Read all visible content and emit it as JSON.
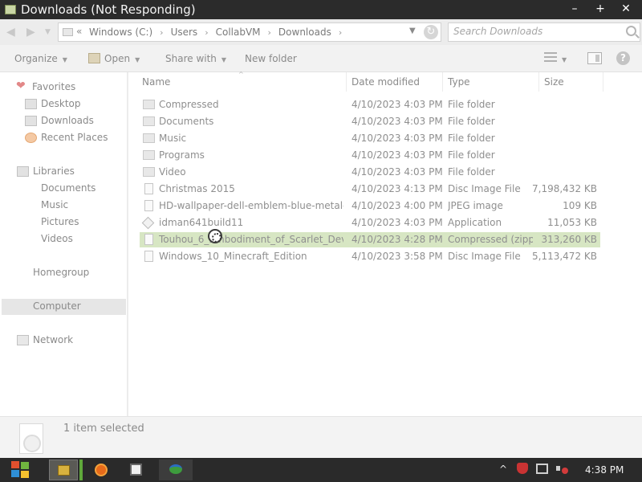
{
  "window": {
    "title": "Downloads (Not Responding)",
    "min_glyph": "–",
    "max_glyph": "+",
    "close_glyph": "✕"
  },
  "address": {
    "back_glyph": "◀",
    "forward_glyph": "▶",
    "recent_glyph": "▼",
    "overflow": "«",
    "crumbs": [
      "Windows (C:)",
      "Users",
      "CollabVM",
      "Downloads"
    ],
    "separator": "›",
    "dropdown_glyph": "▼",
    "refresh_glyph": "↻",
    "search_placeholder": "Search Downloads"
  },
  "toolbar": {
    "organize": "Organize",
    "open": "Open",
    "share_with": "Share with",
    "new_folder": "New folder",
    "caret": "▼",
    "help": "?"
  },
  "nav": {
    "favorites": "Favorites",
    "desktop": "Desktop",
    "downloads": "Downloads",
    "recent_places": "Recent Places",
    "libraries": "Libraries",
    "documents": "Documents",
    "music": "Music",
    "pictures": "Pictures",
    "videos": "Videos",
    "homegroup": "Homegroup",
    "computer": "Computer",
    "network": "Network",
    "heart_glyph": "❤"
  },
  "columns": {
    "name": "Name",
    "date": "Date modified",
    "type": "Type",
    "size": "Size",
    "sort_glyph": "^"
  },
  "files": [
    {
      "name": "Compressed",
      "date": "4/10/2023 4:03 PM",
      "type": "File folder",
      "size": "",
      "icon": "folder-icon"
    },
    {
      "name": "Documents",
      "date": "4/10/2023 4:03 PM",
      "type": "File folder",
      "size": "",
      "icon": "folder-icon"
    },
    {
      "name": "Music",
      "date": "4/10/2023 4:03 PM",
      "type": "File folder",
      "size": "",
      "icon": "folder-icon"
    },
    {
      "name": "Programs",
      "date": "4/10/2023 4:03 PM",
      "type": "File folder",
      "size": "",
      "icon": "folder-icon"
    },
    {
      "name": "Video",
      "date": "4/10/2023 4:03 PM",
      "type": "File folder",
      "size": "",
      "icon": "folder-icon"
    },
    {
      "name": "Christmas 2015",
      "date": "4/10/2023 4:13 PM",
      "type": "Disc Image File",
      "size": "7,198,432 KB",
      "icon": "file-icon"
    },
    {
      "name": "HD-wallpaper-dell-emblem-blue-metal-...",
      "date": "4/10/2023 4:00 PM",
      "type": "JPEG image",
      "size": "109 KB",
      "icon": "file-icon"
    },
    {
      "name": "idman641build11",
      "date": "4/10/2023 4:03 PM",
      "type": "Application",
      "size": "11,053 KB",
      "icon": "application-icon"
    },
    {
      "name": "Touhou_6_Embodiment_of_Scarlet_Devil...",
      "date": "4/10/2023 4:28 PM",
      "type": "Compressed (zipp...",
      "size": "313,260 KB",
      "icon": "file-icon",
      "selected": true
    },
    {
      "name": "Windows_10_Minecraft_Edition",
      "date": "4/10/2023 3:58 PM",
      "type": "Disc Image File",
      "size": "5,113,472 KB",
      "icon": "file-icon"
    }
  ],
  "details": {
    "selection": "1 item selected"
  },
  "taskbar": {
    "tray_chevron": "^",
    "clock": "4:38 PM"
  },
  "colors": {
    "titlebar": "#2b2b2b",
    "selection": "#d7e6c3",
    "taskbar": "#2a2a2a"
  }
}
